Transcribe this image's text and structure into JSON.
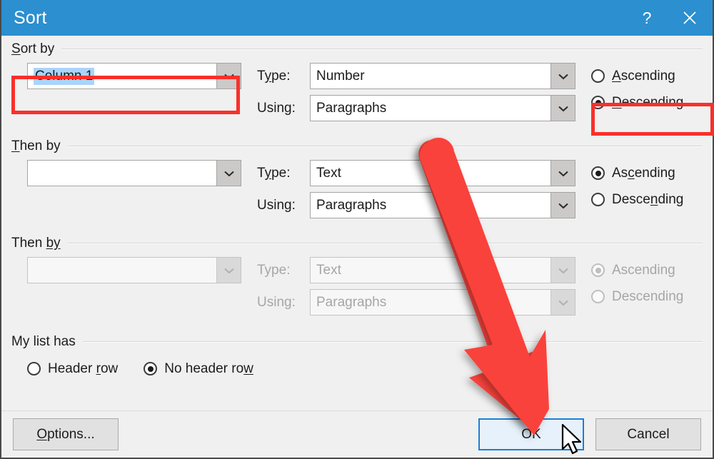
{
  "window": {
    "title": "Sort",
    "help_label": "?",
    "close_label": "✕"
  },
  "sort_by": {
    "group_label_pre": "S",
    "group_label_post": "ort by",
    "column_value": "Column 1",
    "type_caption": "Type:",
    "type_value": "Number",
    "using_caption": "Using:",
    "using_value": "Paragraphs",
    "ascending_label_pre": "A",
    "ascending_label_post": "scending",
    "descending_label_pre": "D",
    "descending_label_post": "escending",
    "selected_order": "Descending"
  },
  "then_by_1": {
    "group_label_pre": "T",
    "group_label_post": "hen by",
    "column_value": "",
    "type_caption": "Type:",
    "type_value": "Text",
    "using_caption": "Using:",
    "using_value": "Paragraphs",
    "ascending_label_a": "As",
    "ascending_label_acc": "c",
    "ascending_label_b": "ending",
    "descending_label_a": "Desce",
    "descending_label_acc": "n",
    "descending_label_b": "ding",
    "selected_order": "Ascending"
  },
  "then_by_2": {
    "group_label_pre": "Then ",
    "group_label_acc": "by",
    "column_value": "",
    "type_caption": "Type:",
    "type_value": "Text",
    "using_caption": "Using:",
    "using_value": "Paragraphs",
    "ascending_label": "Ascending",
    "descending_label": "Descending",
    "selected_order": "Ascending",
    "disabled": true
  },
  "my_list_has": {
    "group_label": "My list has",
    "header_row_a": "Header ",
    "header_row_acc": "r",
    "header_row_b": "ow",
    "no_header_row_a": "No header ro",
    "no_header_row_acc": "w",
    "no_header_row_b": "",
    "selected": "No header row"
  },
  "footer": {
    "options_label_pre": "O",
    "options_label_post": "ptions...",
    "ok_label": "OK",
    "cancel_label": "Cancel"
  },
  "annotations": {
    "arrow_color": "#f9423a",
    "highlight_color": "#f9302b",
    "highlighted_fields": [
      "Sort by column combobox",
      "Descending radio",
      "OK button"
    ]
  },
  "colors": {
    "titlebar": "#2b8fd0",
    "dialog_bg": "#f0f0f0",
    "accent_blue": "#1b7fd4",
    "selection_blue": "#aad4fa"
  }
}
